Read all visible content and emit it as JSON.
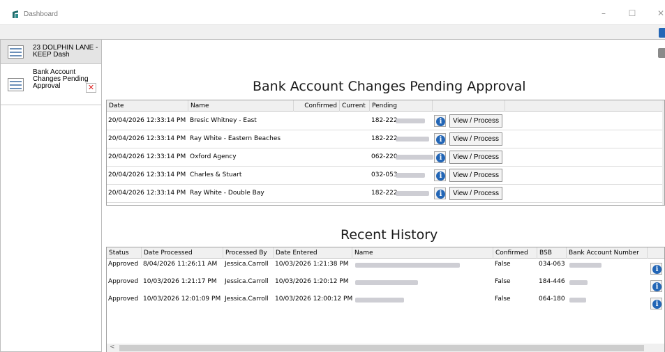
{
  "window": {
    "title": "Dashboard",
    "minimize": "–",
    "maximize": "☐",
    "close": "✕"
  },
  "tabs": [
    {
      "label": "23 DOLPHIN LANE - KEEP Dash"
    },
    {
      "label": "Bank Account Changes Pending Approval",
      "close": "✕"
    }
  ],
  "pending": {
    "title": "Bank Account Changes Pending Approval",
    "columns": [
      "Date",
      "Name",
      "Confirmed",
      "Current",
      "Pending"
    ],
    "view_button": "View / Process",
    "rows": [
      {
        "date": "20/04/2026 12:33:14 PM",
        "name": "Bresic Whitney - East",
        "confirmed": "",
        "current": "",
        "pending": "182-222"
      },
      {
        "date": "20/04/2026 12:33:14 PM",
        "name": "Ray White - Eastern Beaches",
        "confirmed": "",
        "current": "",
        "pending": "182-222"
      },
      {
        "date": "20/04/2026 12:33:14 PM",
        "name": "Oxford Agency",
        "confirmed": "",
        "current": "",
        "pending": "062-220"
      },
      {
        "date": "20/04/2026 12:33:14 PM",
        "name": "Charles & Stuart",
        "confirmed": "",
        "current": "",
        "pending": "032-053"
      },
      {
        "date": "20/04/2026 12:33:14 PM",
        "name": "Ray White - Double Bay",
        "confirmed": "",
        "current": "",
        "pending": "182-222"
      }
    ]
  },
  "history": {
    "title": "Recent History",
    "columns": [
      "Status",
      "Date Processed",
      "Processed By",
      "Date Entered",
      "Name",
      "Confirmed",
      "BSB",
      "Bank Account Number"
    ],
    "rows": [
      {
        "status": "Approved",
        "date_processed": "8/04/2026 11:26:11 AM",
        "processed_by": "Jessica.Carroll",
        "date_entered": "10/03/2026 1:21:38 PM",
        "name": "",
        "confirmed": "False",
        "bsb": "034-063",
        "account": ""
      },
      {
        "status": "Approved",
        "date_processed": "10/03/2026 1:21:17 PM",
        "processed_by": "Jessica.Carroll",
        "date_entered": "10/03/2026 1:20:12 PM",
        "name": "",
        "confirmed": "False",
        "bsb": "184-446",
        "account": ""
      },
      {
        "status": "Approved",
        "date_processed": "10/03/2026 12:01:09 PM",
        "processed_by": "Jessica.Carroll",
        "date_entered": "10/03/2026 12:00:12 PM",
        "name": "",
        "confirmed": "False",
        "bsb": "064-180",
        "account": ""
      }
    ],
    "scroll_left": "<"
  },
  "icons": {
    "app": "app-logo-icon",
    "info": "info-icon",
    "info_glyph": "i"
  },
  "colors": {
    "info_blue": "#2366b6",
    "close_red": "#d22222",
    "app_icon_teal": "#1f6b6b"
  }
}
